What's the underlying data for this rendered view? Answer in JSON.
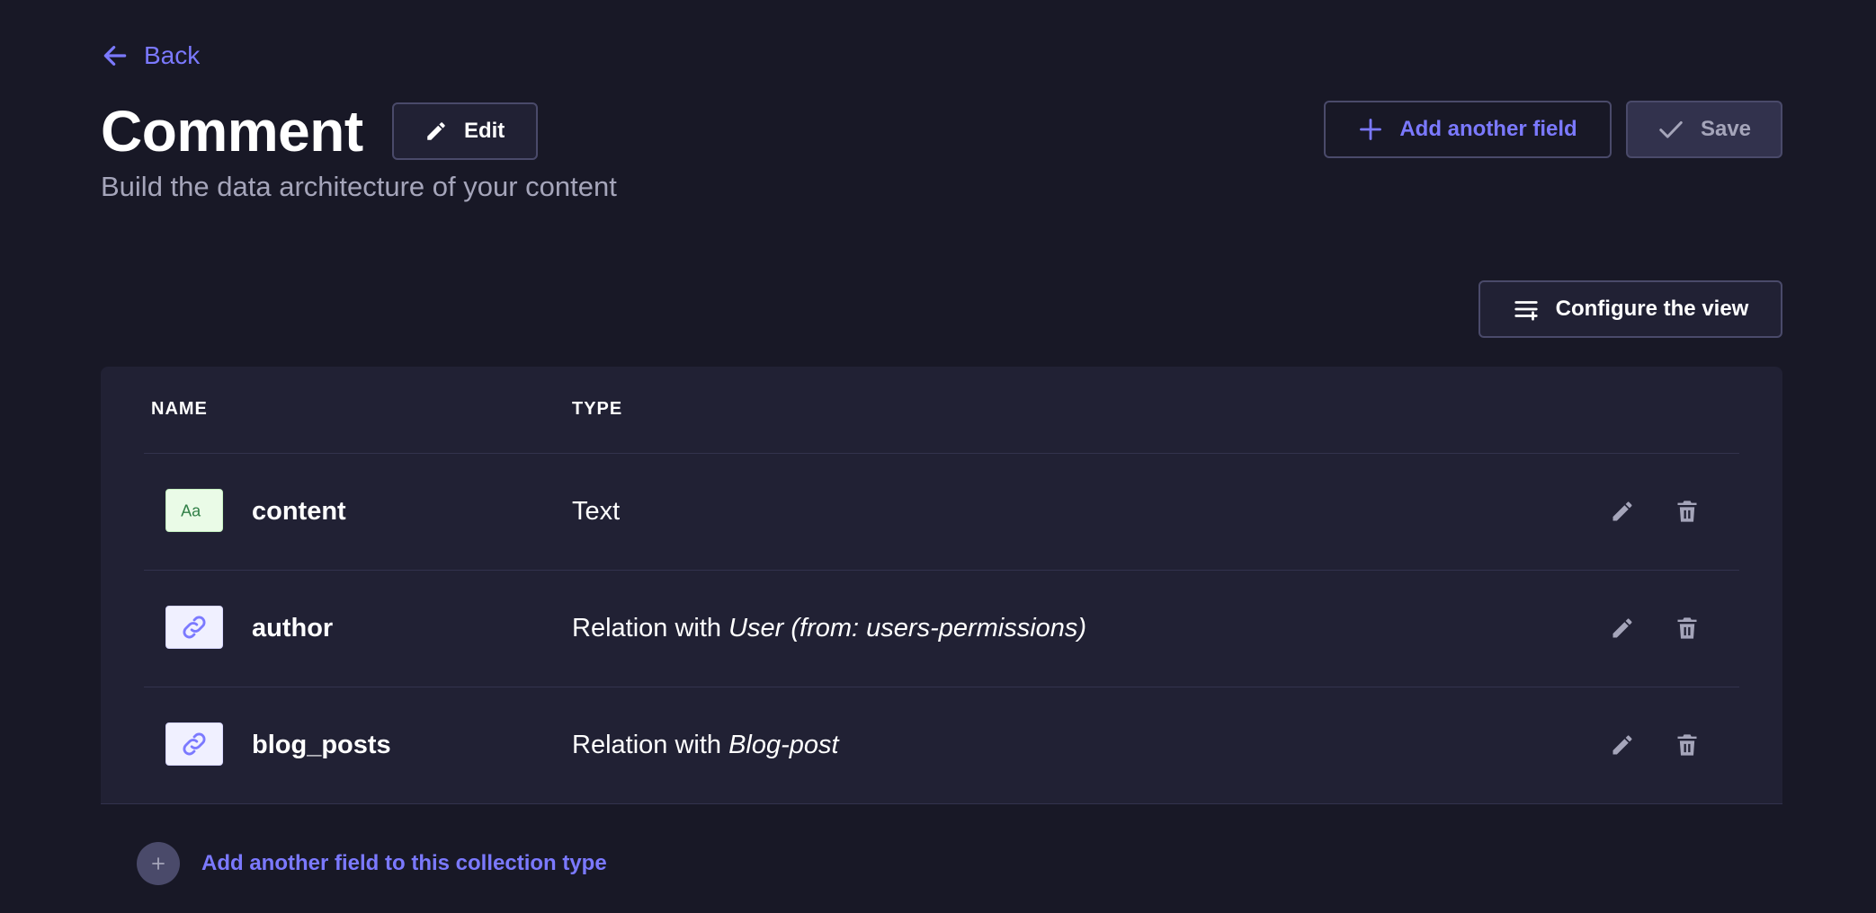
{
  "nav": {
    "back_label": "Back"
  },
  "header": {
    "title": "Comment",
    "edit_label": "Edit",
    "subtitle": "Build the data architecture of your content",
    "add_field_label": "Add another field",
    "save_label": "Save"
  },
  "view": {
    "configure_label": "Configure the view"
  },
  "table": {
    "columns": [
      "NAME",
      "TYPE"
    ],
    "rows": [
      {
        "name": "content",
        "type_prefix": "Text",
        "type_target": "",
        "icon": "text-icon"
      },
      {
        "name": "author",
        "type_prefix": "Relation with ",
        "type_target": "User (from: users-permissions)",
        "icon": "relation-icon"
      },
      {
        "name": "blog_posts",
        "type_prefix": "Relation with ",
        "type_target": "Blog-post",
        "icon": "relation-icon"
      }
    ]
  },
  "footer": {
    "add_field_label": "Add another field to this collection type"
  },
  "colors": {
    "background": "#181826",
    "surface": "#212134",
    "accent": "#7b79ff",
    "border": "#4a4a6a",
    "muted_text": "#a5a5ba"
  }
}
